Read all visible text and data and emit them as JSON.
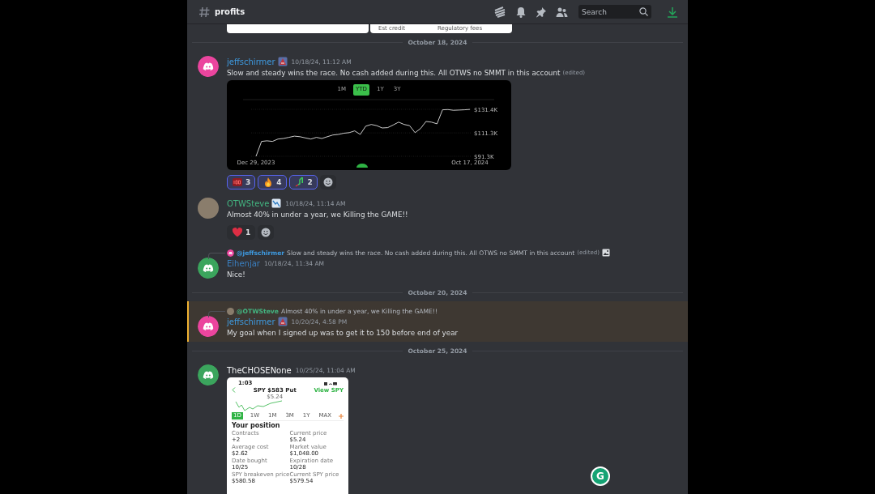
{
  "channel": {
    "name": "profits"
  },
  "search": {
    "placeholder": "Search"
  },
  "cut_off_cards": [
    {
      "kind": "blank"
    },
    {
      "kind": "labels",
      "labels": [
        "Est credit",
        "Regulatory fees"
      ]
    }
  ],
  "feed": [
    {
      "kind": "divider",
      "label": "October 18, 2024"
    },
    {
      "kind": "message",
      "author": "jeffschirmer",
      "color": "#3e9ae0",
      "avatar": {
        "kind": "discord",
        "color": "#eb459e"
      },
      "role_icon": true,
      "time": "10/18/24, 11:12 AM",
      "text": "Slow and steady wins the race.  No cash added during this.  All OTWS no SMMT in this account",
      "edited": "(edited)",
      "attachment": {
        "kind": "chart",
        "ranges": [
          {
            "label": "1M",
            "selected": false
          },
          {
            "label": "YTD",
            "selected": true
          },
          {
            "label": "1Y",
            "selected": false
          },
          {
            "label": "3Y",
            "selected": false
          }
        ],
        "chart_data": {
          "type": "line",
          "categories": [
            "Dec 29, 2023",
            null,
            null,
            null,
            null,
            null,
            null,
            null,
            null,
            null,
            null,
            null,
            null,
            null,
            null,
            null,
            null,
            null,
            null,
            null,
            null,
            null,
            null,
            null,
            null,
            null,
            null,
            null,
            null,
            null,
            null,
            null,
            null,
            null,
            null,
            null,
            null,
            null,
            null,
            "Oct 17, 2024"
          ],
          "grid": true,
          "ylim": [
            91300,
            131400
          ],
          "yticks": [
            {
              "value": 91300,
              "label": "$91.3K"
            },
            {
              "value": 111300,
              "label": "$111.3K"
            },
            {
              "value": 131400,
              "label": "$131.4K"
            }
          ],
          "series": [
            {
              "color": "#ffffff",
              "values": [
                91300,
                104000,
                104500,
                104000,
                106000,
                106500,
                107500,
                108500,
                108000,
                107000,
                106000,
                107500,
                106500,
                108000,
                109500,
                110000,
                111000,
                111500,
                113000,
                110000,
                117000,
                118500,
                117500,
                115500,
                115800,
                118000,
                120500,
                118500,
                117500,
                111500,
                115000,
                121000,
                120500,
                119000,
                131000,
                131200,
                130600,
                130800,
                131000,
                131300
              ]
            }
          ]
        },
        "handle": true
      },
      "reactions": [
        {
          "kind": "hundred",
          "count": "3",
          "selected": true
        },
        {
          "kind": "fire",
          "count": "4",
          "selected": true
        },
        {
          "kind": "chart",
          "count": "2",
          "selected": true
        }
      ]
    },
    {
      "kind": "message",
      "author": "OTWSteve",
      "color": "#43b581",
      "avatar": {
        "kind": "photo",
        "color": "#8a7d6c"
      },
      "role_icon": true,
      "time": "10/18/24, 11:14 AM",
      "text": "Almost 40% in under a year, we Killing the GAME!!",
      "reactions": [
        {
          "kind": "heart",
          "count": "1",
          "selected": false
        }
      ]
    },
    {
      "kind": "message",
      "author": "Eihenjar",
      "color": "#3a7fc0",
      "avatar": {
        "kind": "discord",
        "color": "#3ba55d"
      },
      "time": "10/18/24, 11:34 AM",
      "text": "Nice!",
      "reply": {
        "author": "@jeffschirmer",
        "color": "#3e9ae0",
        "avatar": {
          "kind": "discord",
          "color": "#eb459e"
        },
        "text": "Slow and steady wins the race.  No cash added during this.  All OTWS no SMMT in this account",
        "edited": "(edited)",
        "image_icon": true
      }
    },
    {
      "kind": "divider",
      "label": "October 20, 2024"
    },
    {
      "kind": "message",
      "author": "jeffschirmer",
      "color": "#3e9ae0",
      "avatar": {
        "kind": "discord",
        "color": "#eb459e"
      },
      "role_icon": true,
      "time": "10/20/24, 4:58 PM",
      "text": "My goal when I signed up was to get it to 150 before end of year",
      "highlighted": true,
      "reply": {
        "author": "@OTWSteve",
        "color": "#43b581",
        "avatar": {
          "kind": "photo",
          "color": "#8a7d6c"
        },
        "text": "Almost 40% in under a year, we Killing the GAME!!"
      }
    },
    {
      "kind": "divider",
      "label": "October 25, 2024"
    },
    {
      "kind": "message",
      "author": "TheCHOSENone",
      "color": "#f2f3f5",
      "avatar": {
        "kind": "discord",
        "color": "#3ba55d"
      },
      "time": "10/25/24, 11:04 AM",
      "attachment": {
        "kind": "phone",
        "status_time": "1:03",
        "title": "SPY $583 Put",
        "subtitle": "$5.24",
        "link": "View SPY",
        "ranges": [
          {
            "label": "1D",
            "selected": true
          },
          {
            "label": "1W",
            "selected": false
          },
          {
            "label": "1M",
            "selected": false
          },
          {
            "label": "3M",
            "selected": false
          },
          {
            "label": "1Y",
            "selected": false
          },
          {
            "label": "MAX",
            "selected": false
          }
        ],
        "heading": "Your position",
        "fields": [
          {
            "label": "Contracts",
            "value": "+2"
          },
          {
            "label": "Current price",
            "value": "$5.24"
          },
          {
            "label": "Average cost",
            "value": "$2.62"
          },
          {
            "label": "Market value",
            "value": "$1,048.00"
          },
          {
            "label": "Date bought",
            "value": "10/25"
          },
          {
            "label": "Expiration date",
            "value": "10/28"
          },
          {
            "label": "SPY breakeven price",
            "value": "$580.58"
          },
          {
            "label": "Current SPY price",
            "value": "$579.54"
          }
        ]
      }
    }
  ],
  "assistant_button": {
    "label": "G"
  }
}
